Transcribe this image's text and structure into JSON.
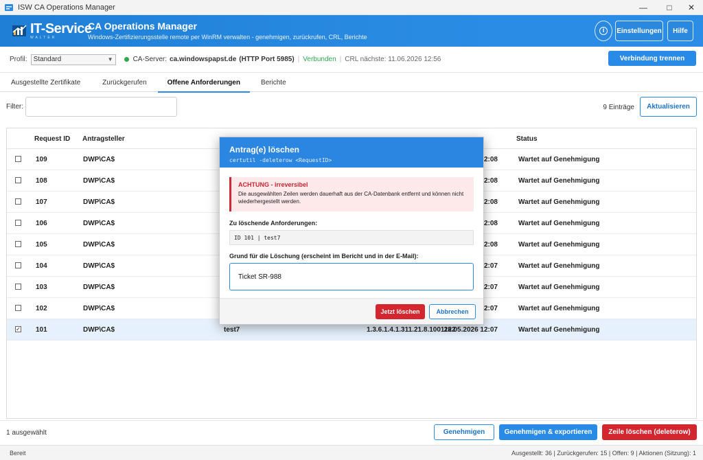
{
  "window": {
    "title": "ISW CA Operations Manager",
    "minimize_icon": "minimize-icon",
    "maximize_icon": "maximize-icon",
    "close_icon": "close-icon"
  },
  "header": {
    "logo_text": "IT-Service",
    "logo_sub": "WALTER",
    "app_title": "CA Operations Manager",
    "app_subtitle": "Windows-Zertifizierungsstelle remote per WinRM verwalten - genehmigen, zurückrufen, CRL, Berichte",
    "info_icon": "info-icon",
    "settings_label": "Einstellungen",
    "help_label": "Hilfe"
  },
  "profilebar": {
    "profile_label": "Profil:",
    "profile_value": "Standard",
    "ca_label": "CA-Server:",
    "ca_value": "ca.windowspapst.de",
    "port": "(HTTP Port 5985)",
    "status": "Verbunden",
    "crl_next": "CRL nächste: 11.06.2026 12:56",
    "disconnect_label": "Verbindung trennen"
  },
  "tabs": [
    {
      "label": "Ausgestellte Zertifikate"
    },
    {
      "label": "Zurückgerufen"
    },
    {
      "label": "Offene Anforderungen"
    },
    {
      "label": "Berichte"
    }
  ],
  "filter": {
    "label": "Filter:",
    "value": "",
    "count": "9 Einträge",
    "refresh_label": "Aktualisieren"
  },
  "table": {
    "headers": [
      "Request ID",
      "Antragsteller",
      "",
      "",
      "",
      "Status"
    ],
    "rows": [
      {
        "id": "109",
        "requester": "DWP\\CA$",
        "subject": "",
        "template": "",
        "time": "12:08",
        "status": "Wartet auf Genehmigung",
        "checked": false
      },
      {
        "id": "108",
        "requester": "DWP\\CA$",
        "subject": "",
        "template": "",
        "time": "12:08",
        "status": "Wartet auf Genehmigung",
        "checked": false
      },
      {
        "id": "107",
        "requester": "DWP\\CA$",
        "subject": "",
        "template": "",
        "time": "12:08",
        "status": "Wartet auf Genehmigung",
        "checked": false
      },
      {
        "id": "106",
        "requester": "DWP\\CA$",
        "subject": "",
        "template": "",
        "time": "12:08",
        "status": "Wartet auf Genehmigung",
        "checked": false
      },
      {
        "id": "105",
        "requester": "DWP\\CA$",
        "subject": "",
        "template": "",
        "time": "12:08",
        "status": "Wartet auf Genehmigung",
        "checked": false
      },
      {
        "id": "104",
        "requester": "DWP\\CA$",
        "subject": "",
        "template": "",
        "time": "12:07",
        "status": "Wartet auf Genehmigung",
        "checked": false
      },
      {
        "id": "103",
        "requester": "DWP\\CA$",
        "subject": "",
        "template": "",
        "time": "12:07",
        "status": "Wartet auf Genehmigung",
        "checked": false
      },
      {
        "id": "102",
        "requester": "DWP\\CA$",
        "subject": "",
        "template": "",
        "time": "12:07",
        "status": "Wartet auf Genehmigung",
        "checked": false
      },
      {
        "id": "101",
        "requester": "DWP\\CA$",
        "subject": "test7",
        "template": "1.3.6.1.4.1.311.21.8.1001122",
        "time": "28.05.2026 12:07",
        "status": "Wartet auf Genehmigung",
        "checked": true
      }
    ]
  },
  "actionbar": {
    "selected_info": "1 ausgewählt",
    "approve_label": "Genehmigen",
    "approve_export_label": "Genehmigen & exportieren",
    "delete_label": "Zeile löschen (deleterow)"
  },
  "statusbar": {
    "left": "Bereit",
    "right": "Ausgestellt: 36  |  Zurückgerufen: 15  |  Offen: 9  |  Aktionen (Sitzung): 1"
  },
  "dialog": {
    "title": "Antrag(e) löschen",
    "command": "certutil -deleterow <RequestID>",
    "warning_title": "ACHTUNG - irreversibel",
    "warning_text": "Die ausgewählten Zeilen werden dauerhaft aus der CA-Datenbank entfernt und können nicht wiederhergestellt werden.",
    "list_label": "Zu löschende Anforderungen:",
    "list_value": "ID  101  |  test7",
    "reason_label": "Grund für die Löschung (erscheint im Bericht und in der E-Mail):",
    "reason_value": "Ticket SR-988",
    "delete_label": "Jetzt löschen",
    "cancel_label": "Abbrechen"
  },
  "colors": {
    "accent": "#2a8be6",
    "header_blue": "#1f7fd6",
    "danger": "#d3262f",
    "success": "#2fa84f",
    "selected_row": "#e7f1fd"
  }
}
